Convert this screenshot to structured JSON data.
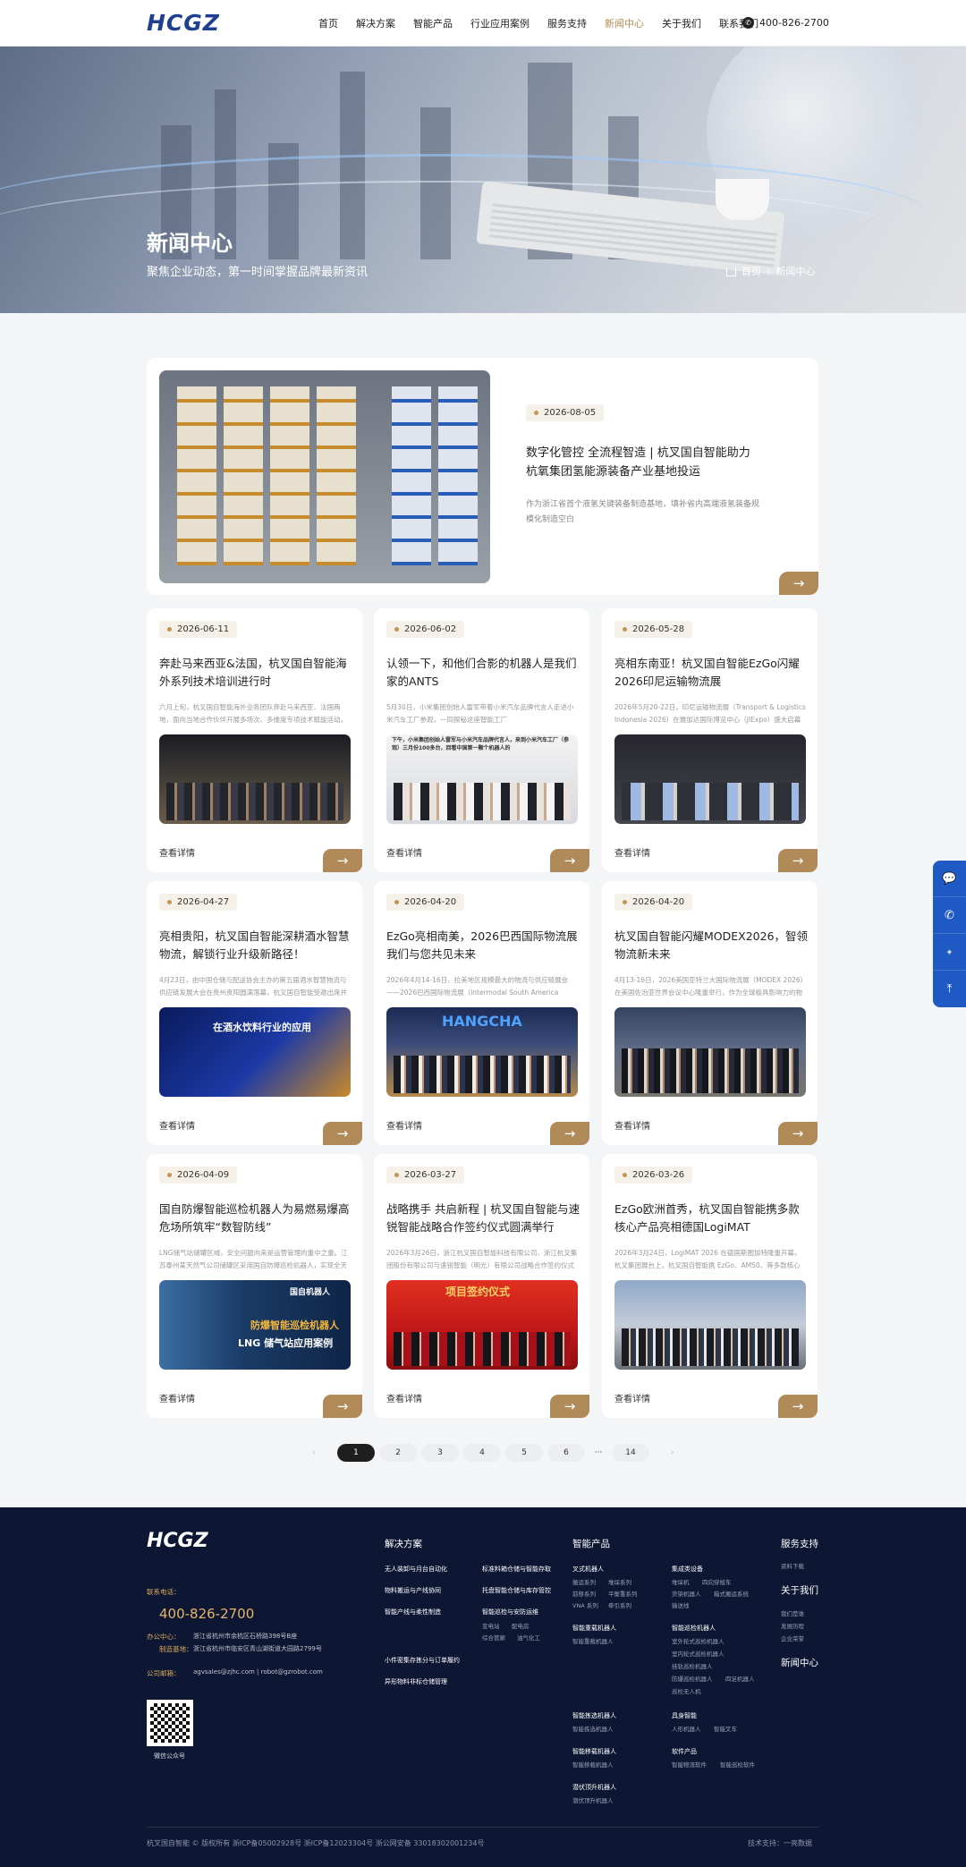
{
  "header": {
    "logo": "HCGZ",
    "nav": [
      "首页",
      "解决方案",
      "智能产品",
      "行业应用案例",
      "服务支持",
      "新闻中心",
      "关于我们",
      "联系我们"
    ],
    "active_nav": "新闻中心",
    "phone": "400-826-2700"
  },
  "hero": {
    "title": "新闻中心",
    "subtitle": "聚焦企业动态，第一时间掌握品牌最新资讯",
    "breadcrumb": [
      "首页",
      "新闻中心"
    ]
  },
  "featured": {
    "date": "2026-08-05",
    "title": "数字化管控 全流程智造 | 杭叉国自智能助力杭氧集团氢能源装备产业基地投运",
    "desc": "作为浙江省首个液氢关键装备制造基地，填补省内高端液氢装备规模化制造空白",
    "arrow": "→"
  },
  "cards": [
    {
      "date": "2026-06-11",
      "title": "奔赴马来西亚&法国，杭叉国自智能海外系列技术培训进行时",
      "desc": "六月上旬，杭叉国自智能海外业务团队奔赴马来西亚、法国两地，面向当地合作伙伴开展多场次、多维度专项技术赋能活动，为海外业务的持续拓展提供坚实保障",
      "more": "查看详情",
      "arrow": "→"
    },
    {
      "date": "2026-06-02",
      "title": "认领一下，和他们合影的机器人是我们家的ANTS",
      "desc": "5月30日，小米集团创始人雷军带着小米汽车品牌代言人走进小米汽车工厂参观，一同探秘这座智能工厂",
      "more": "查看详情",
      "arrow": "→",
      "img_text": "下午，小米集团创始人雷军与小米汽车品牌代言人，来到小米汽车工厂（参观）三月份100多台，回看中国第一颗个机器人的"
    },
    {
      "date": "2026-05-28",
      "title": "亮相东南亚！杭叉国自智能EzGo闪耀2026印尼运输物流展",
      "desc": "2026年5月20-22日，印尼运输物流展（Transport & Logistics Indonesia 2026）在雅加达国际博览中心（JIExpo）盛大启幕",
      "more": "查看详情",
      "arrow": "→"
    },
    {
      "date": "2026-04-27",
      "title": "亮相贵阳，杭叉国自智能深耕酒水智慧物流，解锁行业升级新路径！",
      "desc": "4月23日，由中国仓储与配送协会主办的第五届酒水智慧物流与供应链发展大会在贵州贵阳圆满落幕，杭叉国自智能受邀出席并发表主题演讲",
      "more": "查看详情",
      "arrow": "→",
      "img_text": "在酒水饮料行业的应用"
    },
    {
      "date": "2026-04-20",
      "title": "EzGo亮相南美，2026巴西国际物流展我们与您共见未来",
      "desc": "2026年4月14-16日，拉美地区规模最大的物流与供应链展会——2026巴西国际物流展（Intermodal South America 2026）在圣保罗举办",
      "more": "查看详情",
      "arrow": "→",
      "img_text": "HANGCHA"
    },
    {
      "date": "2026-04-20",
      "title": "杭叉国自智能闪耀MODEX2026，智领物流新未来",
      "desc": "4月13-16日，2026美国亚特兰大国际物流展（MODEX 2026）在美国佐治亚世界会议中心隆重举行，作为全球极具影响力的物流展会",
      "more": "查看详情",
      "arrow": "→"
    },
    {
      "date": "2026-04-09",
      "title": "国自防爆智能巡检机器人为易燃易爆高危场所筑牢“数智防线”",
      "desc": "LNG储气站储罐区域，安全问题向来是运营管理的重中之重。江苏泰州某天然气公司储罐区采用国自防爆巡检机器人，实现全天候自主巡检",
      "more": "查看详情",
      "arrow": "→",
      "img_logo": "国自机器人",
      "img_text": "防爆智能巡检机器人",
      "img_text2": "LNG 储气站应用案例"
    },
    {
      "date": "2026-03-27",
      "title": "战略携手 共启新程 | 杭叉国自智能与速锐智能战略合作签约仪式圆满举行",
      "desc": "2026年3月26日，浙江杭叉国自智能科技有限公司、浙江杭叉集团股份有限公司与速锐智能（明光）有限公司战略合作签约仪式圆满举行",
      "more": "查看详情",
      "arrow": "→",
      "img_text": "项目签约仪式"
    },
    {
      "date": "2026-03-26",
      "title": "EzGo欧洲首秀，杭叉国自智能携多款核心产品亮相德国LogiMAT",
      "desc": "2026年3月24日，LogiMAT 2026 在德国斯图加特隆重开幕，杭叉集团展台上，杭叉国自智能携 EzGo、AMS0、等多款核心产品重磅亮相",
      "more": "查看详情",
      "arrow": "→"
    }
  ],
  "pagination": {
    "prev": "‹",
    "pages": [
      "1",
      "2",
      "3",
      "4",
      "5",
      "6",
      "···",
      "14"
    ],
    "current": "1",
    "next": "›"
  },
  "floating_bar": [
    "wechat-icon",
    "phone-icon",
    "logo-icon",
    "back-to-top-icon"
  ],
  "footer": {
    "logo": "HCGZ",
    "phone_label": "联系电话：",
    "phone": "400-826-2700",
    "office_label": "办公中心：",
    "office": "浙江省杭州市余杭区石桥路398号B座",
    "factory_label": "制造基地：",
    "factory": "浙江省杭州市临安区青山湖街道大园路2799号",
    "email_label": "公司邮箱：",
    "email": "agvsales@zjhc.com | robot@gzrobot.com",
    "qr_label": "微信公众号",
    "solutions": {
      "title": "解决方案",
      "items": [
        "无人装卸与月台自动化",
        "标准料箱仓储与智能存取",
        "物料搬运与产线协同",
        "托盘智能仓储与库存管控",
        "智能产线与柔性制造",
        "智能巡检与安防运维",
        "小件密集存拣分与订单履约",
        "异形物料非标仓储管理"
      ],
      "sub": [
        "变电站",
        "配电房",
        "综合管廊",
        "油气化工"
      ]
    },
    "products": {
      "title": "智能产品",
      "groups": [
        {
          "title": "叉式机器人",
          "items": [
            "搬运系列",
            "堆垛系列",
            "前移系列",
            "平衡重系列",
            "VNA 系列",
            "牵引系列"
          ]
        },
        {
          "title": "集成类设备",
          "items": [
            "堆垛机",
            "四向穿梭车",
            "货架机器人",
            "箱式搬运系统",
            "输送线"
          ]
        },
        {
          "title": "智能重载机器人",
          "items": [
            "智能重载机器人"
          ]
        },
        {
          "title": "智能巡检机器人",
          "items": [
            "室外轮式巡检机器人",
            "室内轮式巡检机器人",
            "挂轨巡检机器人",
            "防爆巡检机器人",
            "四足机器人",
            "巡检无人机"
          ]
        },
        {
          "title": "智能拣选机器人",
          "items": [
            "智能拣选机器人"
          ]
        },
        {
          "title": "具身智能",
          "items": [
            "人形机器人",
            "智能叉车"
          ]
        },
        {
          "title": "智能移载机器人",
          "items": [
            "智能移载机器人"
          ]
        },
        {
          "title": "软件产品",
          "items": [
            "智能物流软件",
            "智能巡检软件"
          ]
        },
        {
          "title": "潜伏顶升机器人",
          "items": [
            "潜伏顶升机器人"
          ]
        }
      ]
    },
    "support": {
      "title": "服务支持",
      "items": [
        "资料下载"
      ]
    },
    "about": {
      "title": "关于我们",
      "items": [
        "我们是谁",
        "发展历程",
        "企业荣誉"
      ]
    },
    "news": {
      "title": "新闻中心"
    },
    "copyright": "杭叉国自智能 © 版权所有 浙ICP备05002928号 浙ICP备12023304号 浙公网安备 33018302001234号",
    "tech_support": "技术支持：一亮数据"
  }
}
